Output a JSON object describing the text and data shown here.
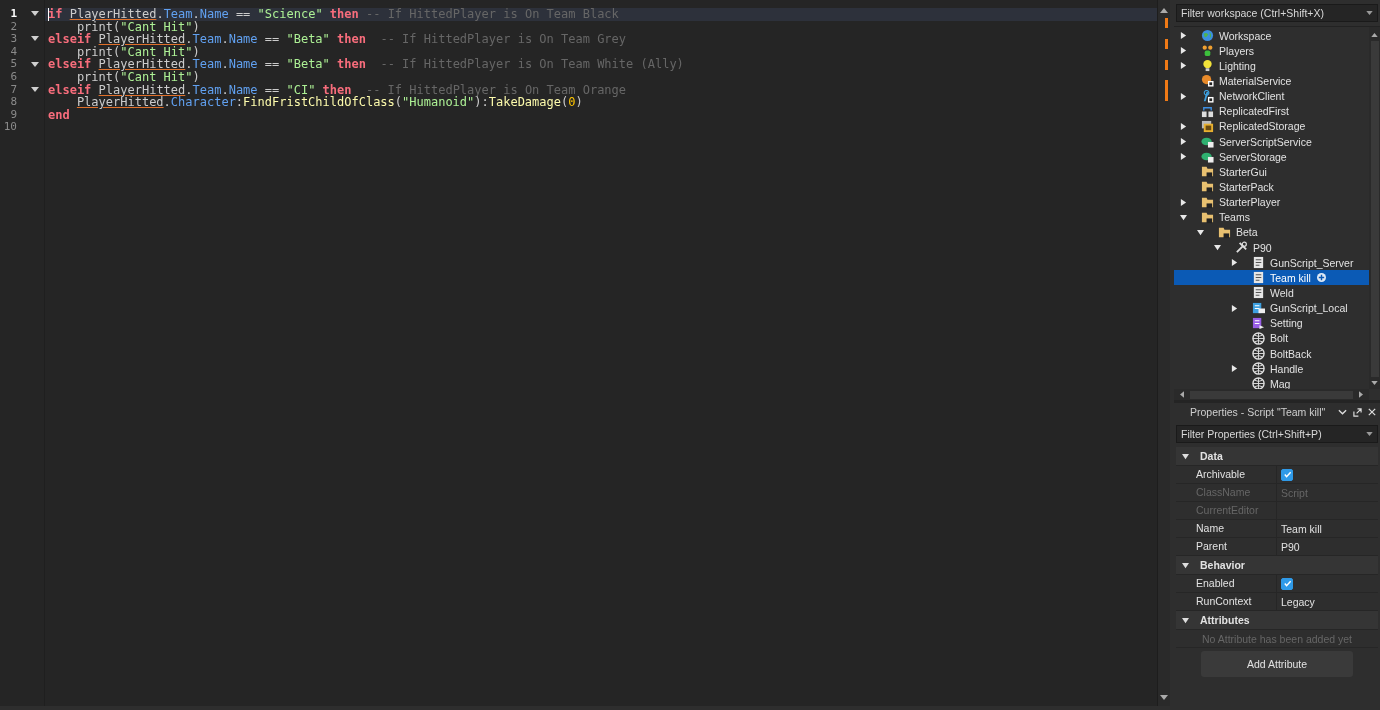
{
  "editor": {
    "lines": [
      {
        "number": "1",
        "current": true,
        "expanded": true,
        "tokens": [
          {
            "kind": "keyword",
            "text": "if "
          },
          {
            "kind": "warn",
            "text": "PlayerHitted"
          },
          {
            "kind": "plain",
            "text": "."
          },
          {
            "kind": "prop",
            "text": "Team"
          },
          {
            "kind": "plain",
            "text": "."
          },
          {
            "kind": "prop",
            "text": "Name"
          },
          {
            "kind": "plain",
            "text": " == "
          },
          {
            "kind": "string",
            "text": "\"Science\" "
          },
          {
            "kind": "keyword",
            "text": "then"
          },
          {
            "kind": "comment",
            "text": " -- If HittedPlayer is On Team Black"
          }
        ]
      },
      {
        "number": "2",
        "current": false,
        "tokens": [
          {
            "kind": "plain",
            "text": "    print("
          },
          {
            "kind": "string",
            "text": "\"Cant Hit\""
          },
          {
            "kind": "plain",
            "text": ")"
          }
        ]
      },
      {
        "number": "3",
        "current": false,
        "expanded": true,
        "tokens": [
          {
            "kind": "keyword",
            "text": "elseif "
          },
          {
            "kind": "warn",
            "text": "PlayerHitted"
          },
          {
            "kind": "plain",
            "text": "."
          },
          {
            "kind": "prop",
            "text": "Team"
          },
          {
            "kind": "plain",
            "text": "."
          },
          {
            "kind": "prop",
            "text": "Name"
          },
          {
            "kind": "plain",
            "text": " == "
          },
          {
            "kind": "string",
            "text": "\"Beta\" "
          },
          {
            "kind": "keyword",
            "text": "then"
          },
          {
            "kind": "comment",
            "text": "  -- If HittedPlayer is On Team Grey"
          }
        ]
      },
      {
        "number": "4",
        "current": false,
        "tokens": [
          {
            "kind": "plain",
            "text": "    print("
          },
          {
            "kind": "string",
            "text": "\"Cant Hit\""
          },
          {
            "kind": "plain",
            "text": ")"
          }
        ]
      },
      {
        "number": "5",
        "current": false,
        "expanded": true,
        "tokens": [
          {
            "kind": "keyword",
            "text": "elseif "
          },
          {
            "kind": "warn",
            "text": "PlayerHitted"
          },
          {
            "kind": "plain",
            "text": "."
          },
          {
            "kind": "prop",
            "text": "Team"
          },
          {
            "kind": "plain",
            "text": "."
          },
          {
            "kind": "prop",
            "text": "Name"
          },
          {
            "kind": "plain",
            "text": " == "
          },
          {
            "kind": "string",
            "text": "\"Beta\" "
          },
          {
            "kind": "keyword",
            "text": "then"
          },
          {
            "kind": "comment",
            "text": "  -- If HittedPlayer is On Team White (Ally)"
          }
        ]
      },
      {
        "number": "6",
        "current": false,
        "tokens": [
          {
            "kind": "plain",
            "text": "    print("
          },
          {
            "kind": "string",
            "text": "\"Cant Hit\""
          },
          {
            "kind": "plain",
            "text": ")"
          }
        ]
      },
      {
        "number": "7",
        "current": false,
        "expanded": true,
        "tokens": [
          {
            "kind": "keyword",
            "text": "elseif "
          },
          {
            "kind": "warn",
            "text": "PlayerHitted"
          },
          {
            "kind": "plain",
            "text": "."
          },
          {
            "kind": "prop",
            "text": "Team"
          },
          {
            "kind": "plain",
            "text": "."
          },
          {
            "kind": "prop",
            "text": "Name"
          },
          {
            "kind": "plain",
            "text": " == "
          },
          {
            "kind": "string",
            "text": "\"CI\" "
          },
          {
            "kind": "keyword",
            "text": "then"
          },
          {
            "kind": "comment",
            "text": "  -- If HittedPlayer is On Team Orange"
          }
        ]
      },
      {
        "number": "8",
        "current": false,
        "indented": true,
        "tokens": [
          {
            "kind": "warn",
            "text": "PlayerHitted"
          },
          {
            "kind": "plain",
            "text": "."
          },
          {
            "kind": "prop",
            "text": "Character"
          },
          {
            "kind": "plain",
            "text": ":"
          },
          {
            "kind": "func",
            "text": "FindFristChildOfClass"
          },
          {
            "kind": "plain",
            "text": "("
          },
          {
            "kind": "string",
            "text": "\"Humanoid\""
          },
          {
            "kind": "plain",
            "text": "):"
          },
          {
            "kind": "func",
            "text": "TakeDamage"
          },
          {
            "kind": "plain",
            "text": "("
          },
          {
            "kind": "number",
            "text": "0"
          },
          {
            "kind": "plain",
            "text": ")"
          }
        ]
      },
      {
        "number": "9",
        "current": false,
        "tokens": [
          {
            "kind": "keyword",
            "text": "end"
          }
        ]
      },
      {
        "number": "10",
        "current": false
      }
    ]
  },
  "explorer": {
    "filter_placeholder": "Filter workspace (Ctrl+Shift+X)",
    "items": [
      {
        "label": "Workspace",
        "kind": "globe",
        "expanded": false,
        "selected": false
      },
      {
        "label": "Players",
        "kind": "players",
        "expanded": false,
        "selected": false
      },
      {
        "label": "Lighting",
        "kind": "bulb",
        "expanded": false,
        "selected": false
      },
      {
        "label": "MaterialService",
        "kind": "material",
        "selected": false
      },
      {
        "label": "NetworkClient",
        "kind": "network",
        "expanded": false,
        "selected": false
      },
      {
        "label": "ReplicatedFirst",
        "kind": "replicated",
        "selected": false
      },
      {
        "label": "ReplicatedStorage",
        "kind": "storage",
        "expanded": false,
        "selected": false
      },
      {
        "label": "ServerScriptService",
        "kind": "cloud",
        "expanded": false,
        "selected": false
      },
      {
        "label": "ServerStorage",
        "kind": "cloud",
        "expanded": false,
        "selected": false
      },
      {
        "label": "StarterGui",
        "kind": "folder",
        "selected": false
      },
      {
        "label": "StarterPack",
        "kind": "folder",
        "selected": false
      },
      {
        "label": "StarterPlayer",
        "kind": "folder",
        "expanded": false,
        "selected": false
      },
      {
        "label": "Teams",
        "kind": "folder",
        "expanded": true,
        "selected": false,
        "children": [
          {
            "label": "Beta",
            "kind": "folder",
            "expanded": true,
            "selected": false,
            "children": [
              {
                "label": "P90",
                "kind": "tool",
                "expanded": true,
                "selected": false,
                "children": [
                  {
                    "label": "GunScript_Server",
                    "kind": "script",
                    "expanded": false,
                    "selected": false
                  },
                  {
                    "label": "Team kill",
                    "kind": "script",
                    "selected": true
                  },
                  {
                    "label": "Weld",
                    "kind": "script",
                    "selected": false
                  },
                  {
                    "label": "GunScript_Local",
                    "kind": "localscript",
                    "expanded": false,
                    "selected": false
                  },
                  {
                    "label": "Setting",
                    "kind": "modulescript",
                    "selected": false
                  },
                  {
                    "label": "Bolt",
                    "kind": "part",
                    "selected": false
                  },
                  {
                    "label": "BoltBack",
                    "kind": "part",
                    "selected": false
                  },
                  {
                    "label": "Handle",
                    "kind": "part",
                    "expanded": false,
                    "selected": false
                  },
                  {
                    "label": "Mag",
                    "kind": "part",
                    "selected": false
                  }
                ]
              }
            ]
          }
        ]
      }
    ]
  },
  "properties": {
    "title": "Properties - Script \"Team kill\"",
    "filter_placeholder": "Filter Properties (Ctrl+Shift+P)",
    "sections": [
      {
        "name": "Data",
        "expanded": true,
        "rows": [
          {
            "name": "Archivable",
            "kind": "checkbox",
            "checked": true,
            "disabled": false
          },
          {
            "name": "ClassName",
            "kind": "text",
            "value": "Script",
            "disabled": true
          },
          {
            "name": "CurrentEditor",
            "kind": "text",
            "disabled": true
          },
          {
            "name": "Name",
            "kind": "text",
            "value": "Team kill",
            "disabled": false
          },
          {
            "name": "Parent",
            "kind": "text",
            "value": "P90",
            "disabled": false
          }
        ]
      },
      {
        "name": "Behavior",
        "expanded": true,
        "rows": [
          {
            "name": "Enabled",
            "kind": "checkbox",
            "checked": true,
            "disabled": false
          },
          {
            "name": "RunContext",
            "kind": "text",
            "value": "Legacy",
            "disabled": false
          }
        ]
      },
      {
        "name": "Attributes",
        "expanded": true,
        "empty_text": "No Attribute has been added yet",
        "button": "Add Attribute"
      }
    ]
  }
}
